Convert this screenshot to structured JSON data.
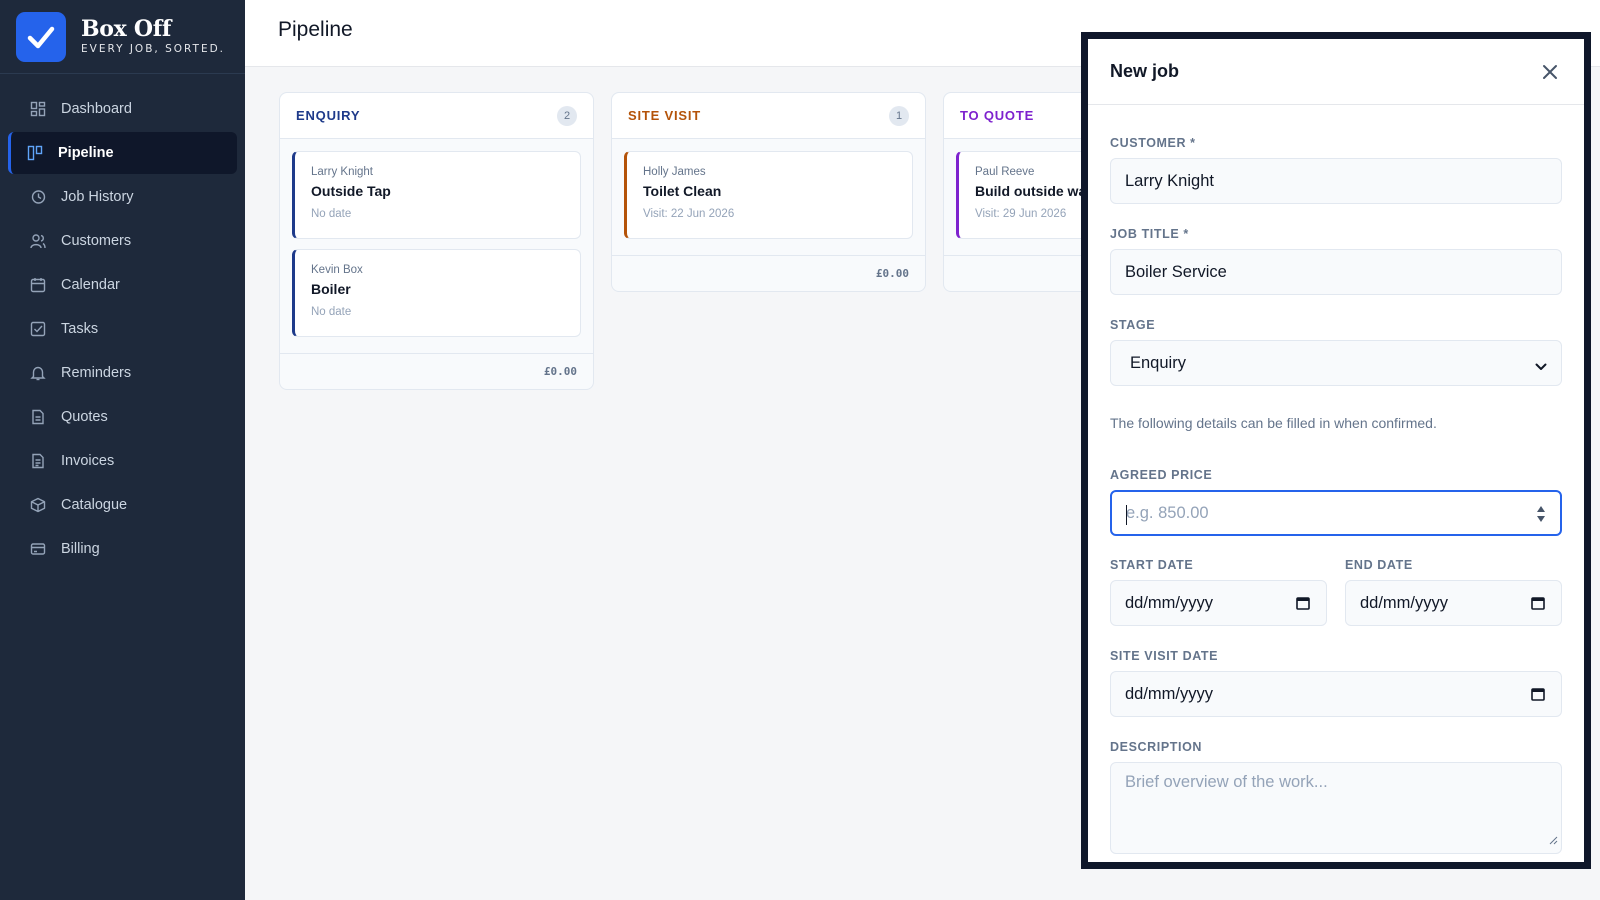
{
  "brand": {
    "name": "Box Off",
    "tagline": "EVERY JOB, SORTED."
  },
  "sidebar": {
    "items": [
      {
        "label": "Dashboard",
        "icon": "dashboard-icon"
      },
      {
        "label": "Pipeline",
        "icon": "pipeline-icon",
        "active": true
      },
      {
        "label": "Job History",
        "icon": "history-icon"
      },
      {
        "label": "Customers",
        "icon": "users-icon"
      },
      {
        "label": "Calendar",
        "icon": "calendar-icon"
      },
      {
        "label": "Tasks",
        "icon": "tasks-icon"
      },
      {
        "label": "Reminders",
        "icon": "bell-icon"
      },
      {
        "label": "Quotes",
        "icon": "document-icon"
      },
      {
        "label": "Invoices",
        "icon": "invoice-icon"
      },
      {
        "label": "Catalogue",
        "icon": "box-icon"
      },
      {
        "label": "Billing",
        "icon": "card-icon"
      }
    ]
  },
  "header": {
    "title": "Pipeline"
  },
  "board": {
    "columns": [
      {
        "title": "ENQUIRY",
        "count": "2",
        "color": "#1e3a8a",
        "total": "£0.00",
        "cards": [
          {
            "customer": "Larry Knight",
            "title": "Outside Tap",
            "date": "No date"
          },
          {
            "customer": "Kevin Box",
            "title": "Boiler",
            "date": "No date"
          }
        ]
      },
      {
        "title": "SITE VISIT",
        "count": "1",
        "color": "#b45309",
        "total": "£0.00",
        "cards": [
          {
            "customer": "Holly James",
            "title": "Toilet Clean",
            "date": "Visit: 22 Jun 2026"
          }
        ]
      },
      {
        "title": "TO QUOTE",
        "count": "",
        "color": "#7e22ce",
        "total": "",
        "cards": [
          {
            "customer": "Paul Reeve",
            "title": "Build outside wal",
            "date": "Visit: 29 Jun 2026"
          }
        ]
      }
    ]
  },
  "modal": {
    "title": "New job",
    "customer_label": "CUSTOMER *",
    "customer_value": "Larry Knight",
    "job_title_label": "JOB TITLE *",
    "job_title_value": "Boiler Service",
    "stage_label": "STAGE",
    "stage_value": "Enquiry",
    "helper": "The following details can be filled in when confirmed.",
    "price_label": "AGREED PRICE",
    "price_placeholder": "e.g. 850.00",
    "start_label": "START DATE",
    "start_value": "dd/mm/yyyy",
    "end_label": "END DATE",
    "end_value": "dd/mm/yyyy",
    "site_visit_label": "SITE VISIT DATE",
    "site_visit_value": "dd/mm/yyyy",
    "description_label": "DESCRIPTION",
    "description_placeholder": "Brief overview of the work..."
  }
}
